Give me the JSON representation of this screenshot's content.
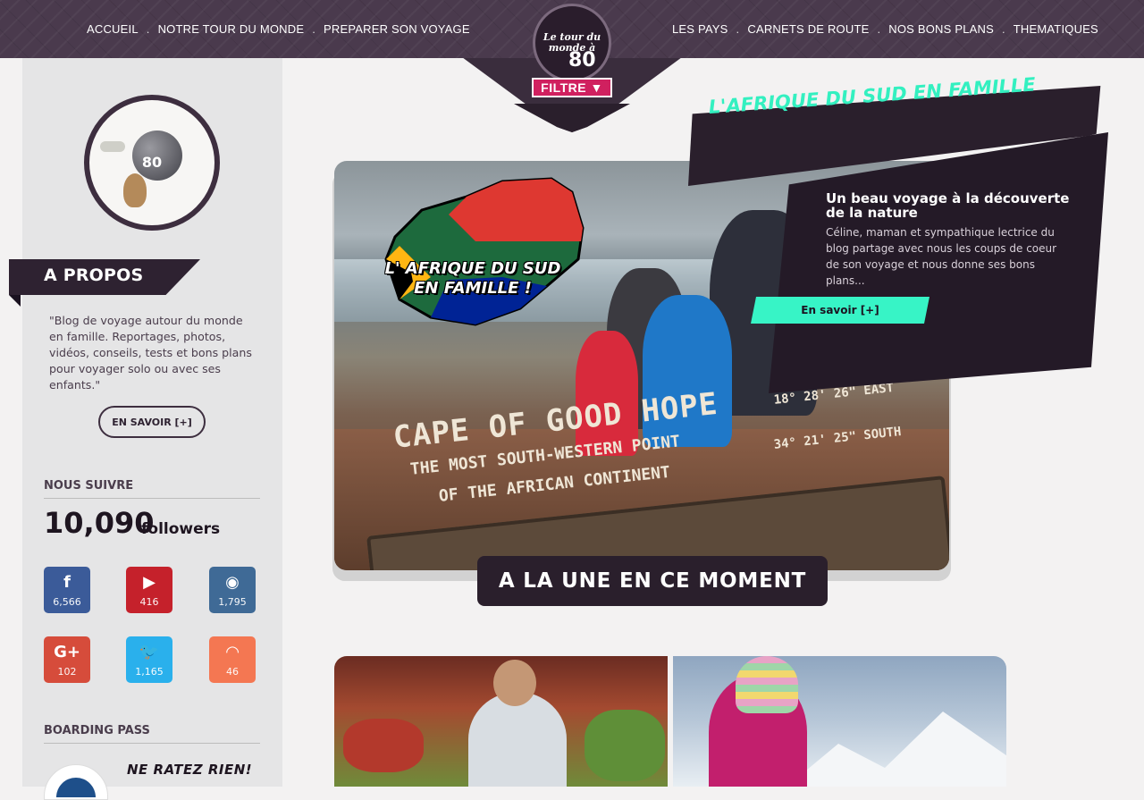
{
  "nav": {
    "left": [
      "ACCUEIL",
      "NOTRE TOUR DU MONDE",
      "PREPARER SON VOYAGE"
    ],
    "right": [
      "LES PAYS",
      "CARNETS DE ROUTE",
      "NOS BONS PLANS",
      "THEMATIQUES"
    ],
    "separator": "."
  },
  "logo": {
    "text": "Le tour du monde à",
    "number": "80",
    "filter_label": "FILTRE ▼"
  },
  "sidebar": {
    "about_title": "A PROPOS",
    "about_text": "\"Blog de voyage autour du monde en famille. Reportages, photos, vidéos, conseils, tests et bons plans pour voyager solo ou avec ses enfants.\"",
    "about_button": "EN SAVOIR [+]",
    "follow_heading": "NOUS SUIVRE",
    "followers_count": "10,090",
    "followers_label": "followers",
    "social": [
      {
        "network": "facebook",
        "icon": "f",
        "count": "6,566",
        "color": "#3b5b99"
      },
      {
        "network": "youtube",
        "icon": "▶",
        "count": "416",
        "color": "#c5212b"
      },
      {
        "network": "instagram",
        "icon": "◉",
        "count": "1,795",
        "color": "#3f6a96"
      },
      {
        "network": "google-plus",
        "icon": "G+",
        "count": "102",
        "color": "#d64c3b"
      },
      {
        "network": "twitter",
        "icon": "🐦",
        "count": "1,165",
        "color": "#2ab0ec"
      },
      {
        "network": "rss",
        "icon": "◠",
        "count": "46",
        "color": "#f47752"
      }
    ],
    "boarding_heading": "BOARDING PASS",
    "ne_ratez": "NE RATEZ RIEN!"
  },
  "hero": {
    "title": "L'AFRIQUE DU SUD EN FAMILLE",
    "map_caption": "L' AFRIQUE DU SUD EN FAMILLE !",
    "sign_line1": "CAPE OF GOOD HOPE",
    "sign_line2": "THE MOST SOUTH-WESTERN POINT",
    "sign_line3": "OF THE AFRICAN CONTINENT",
    "sign_right1": "18° 28' 26\"  EAST",
    "sign_right2": "34° 21' 25\"  SOUTH",
    "info_title": "Un beau voyage à la découverte de la nature",
    "info_body": "Céline, maman et sympathique lectrice du blog partage avec nous les coups de coeur de son voyage et nous donne ses bons plans...",
    "info_button": "En savoir [+]",
    "une_label": "A LA UNE EN CE MOMENT"
  },
  "colors": {
    "accent": "#33f0c0",
    "dark": "#2a1f2c",
    "brand_pink": "#d0205f"
  }
}
